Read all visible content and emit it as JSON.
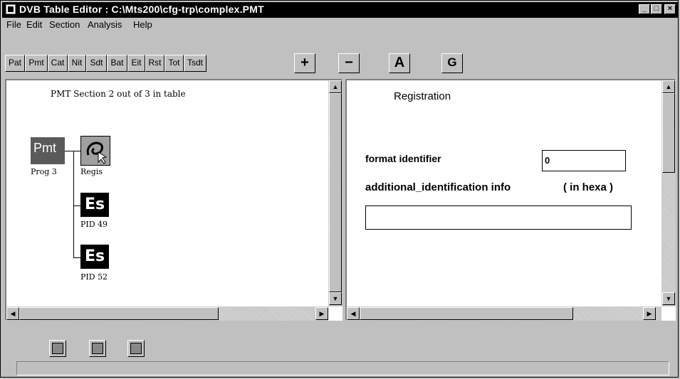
{
  "window": {
    "title": "DVB Table Editor : C:\\Mts200\\cfg-trp\\complex.PMT"
  },
  "menu": [
    "File",
    "Edit",
    "Section",
    "Analysis",
    "Help"
  ],
  "tabs": [
    "Pat",
    "Pmt",
    "Cat",
    "Nit",
    "Sdt",
    "Bat",
    "Eit",
    "Rst",
    "Tot",
    "Tsdt"
  ],
  "tools": {
    "add": "+",
    "remove": "−",
    "a": "A",
    "g": "G"
  },
  "tree": {
    "header": "PMT Section 2 out of 3 in table",
    "root": {
      "box": "Pmt",
      "label": "Prog 3"
    },
    "registration": {
      "label": "Regis"
    },
    "es1": {
      "box": "Es",
      "label": "PID 49"
    },
    "es2": {
      "box": "Es",
      "label": "PID 52"
    }
  },
  "detail": {
    "heading": "Registration",
    "format_label": "format identifier",
    "format_value": "0",
    "addl_label": "additional_identification info",
    "addl_hint": "( in hexa )",
    "addl_value": ""
  },
  "icons": {
    "app": "app-icon",
    "minimize": "minimize-icon",
    "maximize": "maximize-icon",
    "close": "close-icon"
  }
}
